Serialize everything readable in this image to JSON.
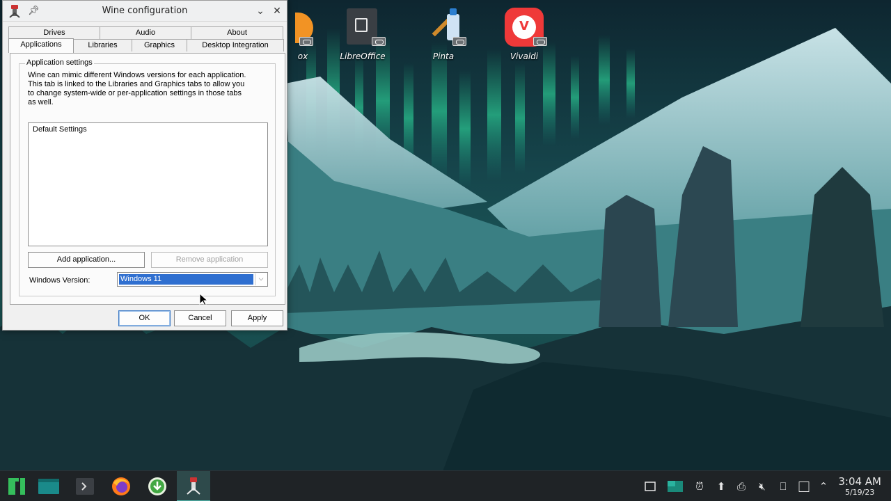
{
  "window": {
    "title": "Wine configuration",
    "tabs_row1": [
      "Drives",
      "Audio",
      "About"
    ],
    "tabs_row2": [
      "Applications",
      "Libraries",
      "Graphics",
      "Desktop Integration"
    ],
    "active_tab": "Applications",
    "group_title": "Application settings",
    "description": "Wine can mimic different Windows versions for each application.\nThis tab is linked to the Libraries and Graphics tabs to allow you\nto change system-wide or per-application settings in those tabs\nas well.",
    "app_list": [
      "Default Settings"
    ],
    "add_button": "Add application...",
    "remove_button": "Remove application",
    "version_label": "Windows Version:",
    "version_value": "Windows 11",
    "ok_button": "OK",
    "cancel_button": "Cancel",
    "apply_button": "Apply"
  },
  "desktop_icons": [
    {
      "label": "ox",
      "icon": "virtualbox-icon"
    },
    {
      "label": "LibreOffice",
      "icon": "libreoffice-icon"
    },
    {
      "label": "Pinta",
      "icon": "pinta-icon"
    },
    {
      "label": "Vivaldi",
      "icon": "vivaldi-icon"
    }
  ],
  "taskbar": {
    "apps": [
      "manjaro-menu-icon",
      "file-manager-icon",
      "terminal-icon",
      "firefox-icon",
      "downloader-icon",
      "wine-icon"
    ],
    "tray": [
      "show-desktop-icon",
      "workspace-icon",
      "notifications-icon",
      "updates-icon",
      "clipboard-icon",
      "volume-muted-icon",
      "usb-icon",
      "network-icon",
      "expand-tray-icon"
    ],
    "time": "3:04 AM",
    "date": "5/19/23"
  },
  "colors": {
    "selection": "#2f6fd0",
    "taskbar": "#1f2326",
    "vivaldi": "#ef3939"
  }
}
